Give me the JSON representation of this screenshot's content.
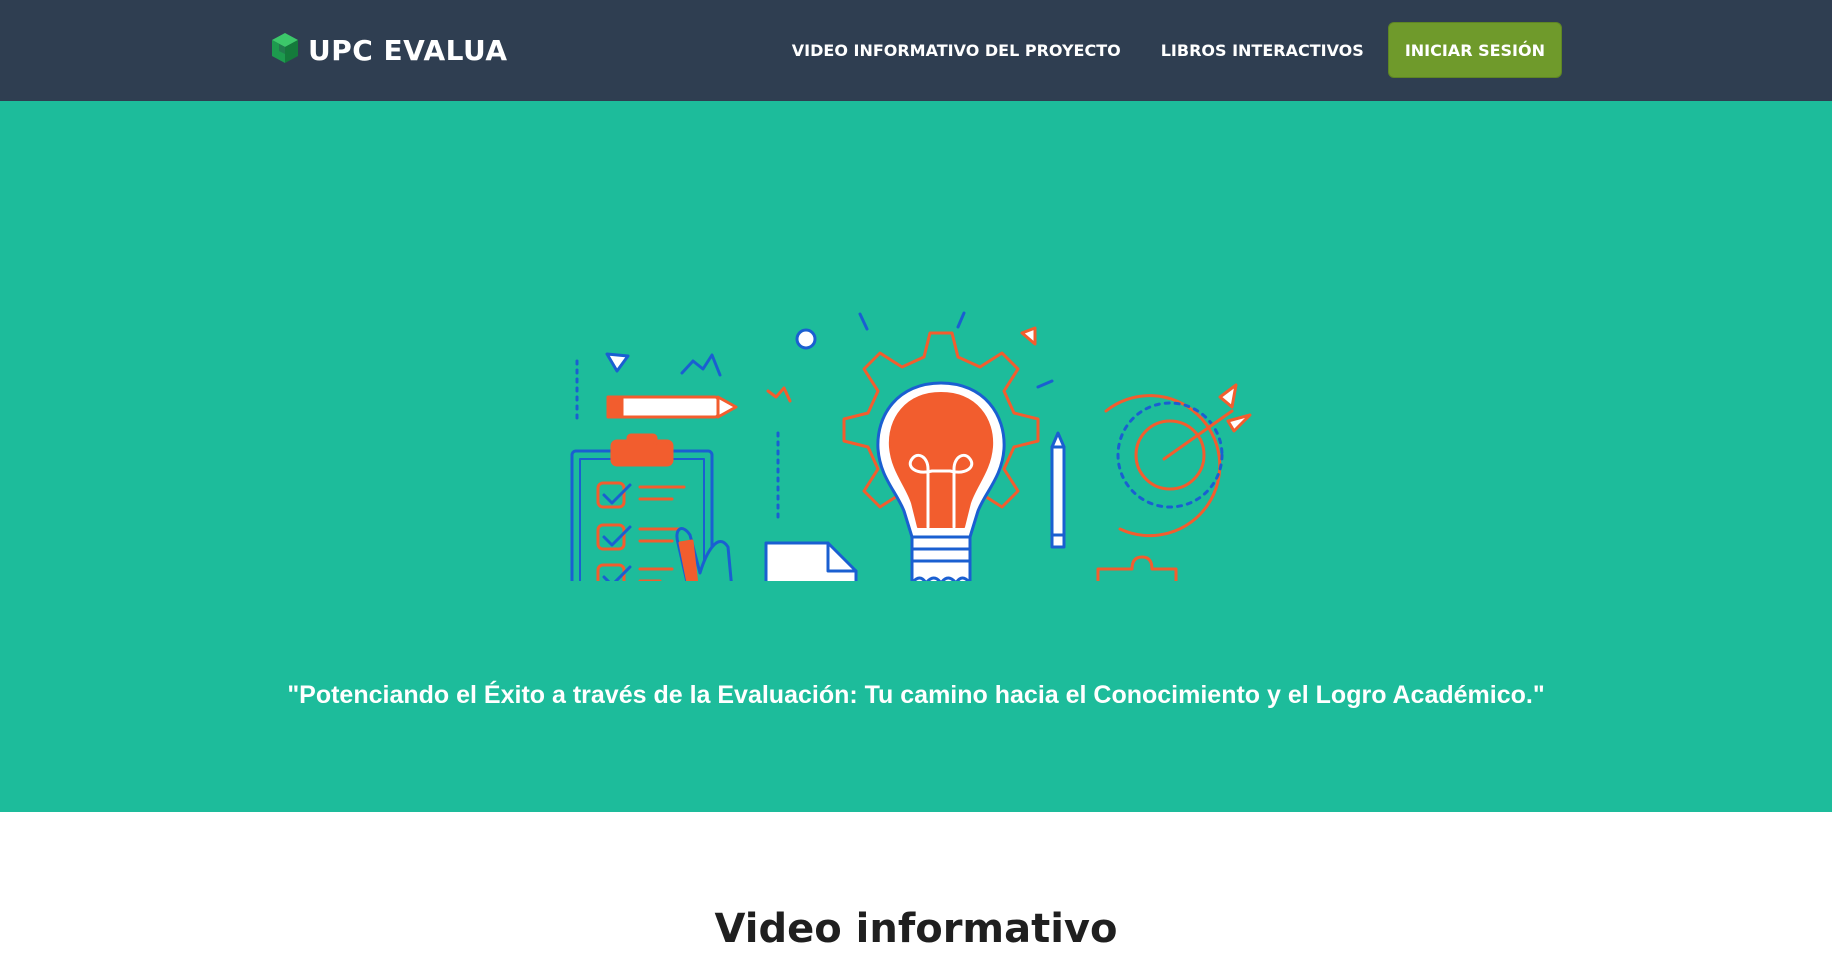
{
  "navbar": {
    "brand": "UPC EVALUA",
    "brand_icon": "cube-logo-icon",
    "links": [
      {
        "label": "VIDEO INFORMATIVO DEL PROYECTO"
      },
      {
        "label": "LIBROS INTERACTIVOS"
      }
    ],
    "login_label": "INICIAR SESIÓN"
  },
  "hero": {
    "illustration": "education-ideas-illustration",
    "tagline": "\"Potenciando el Éxito a través de la Evaluación: Tu camino hacia el Conocimiento y el Logro Académico.\""
  },
  "section": {
    "title": "Video informativo"
  },
  "colors": {
    "navbar": "#2f3e51",
    "hero": "#1dbc9b",
    "login_button": "#6f9a2b",
    "accent_orange": "#f25d2e",
    "accent_blue": "#1a5fd1"
  }
}
